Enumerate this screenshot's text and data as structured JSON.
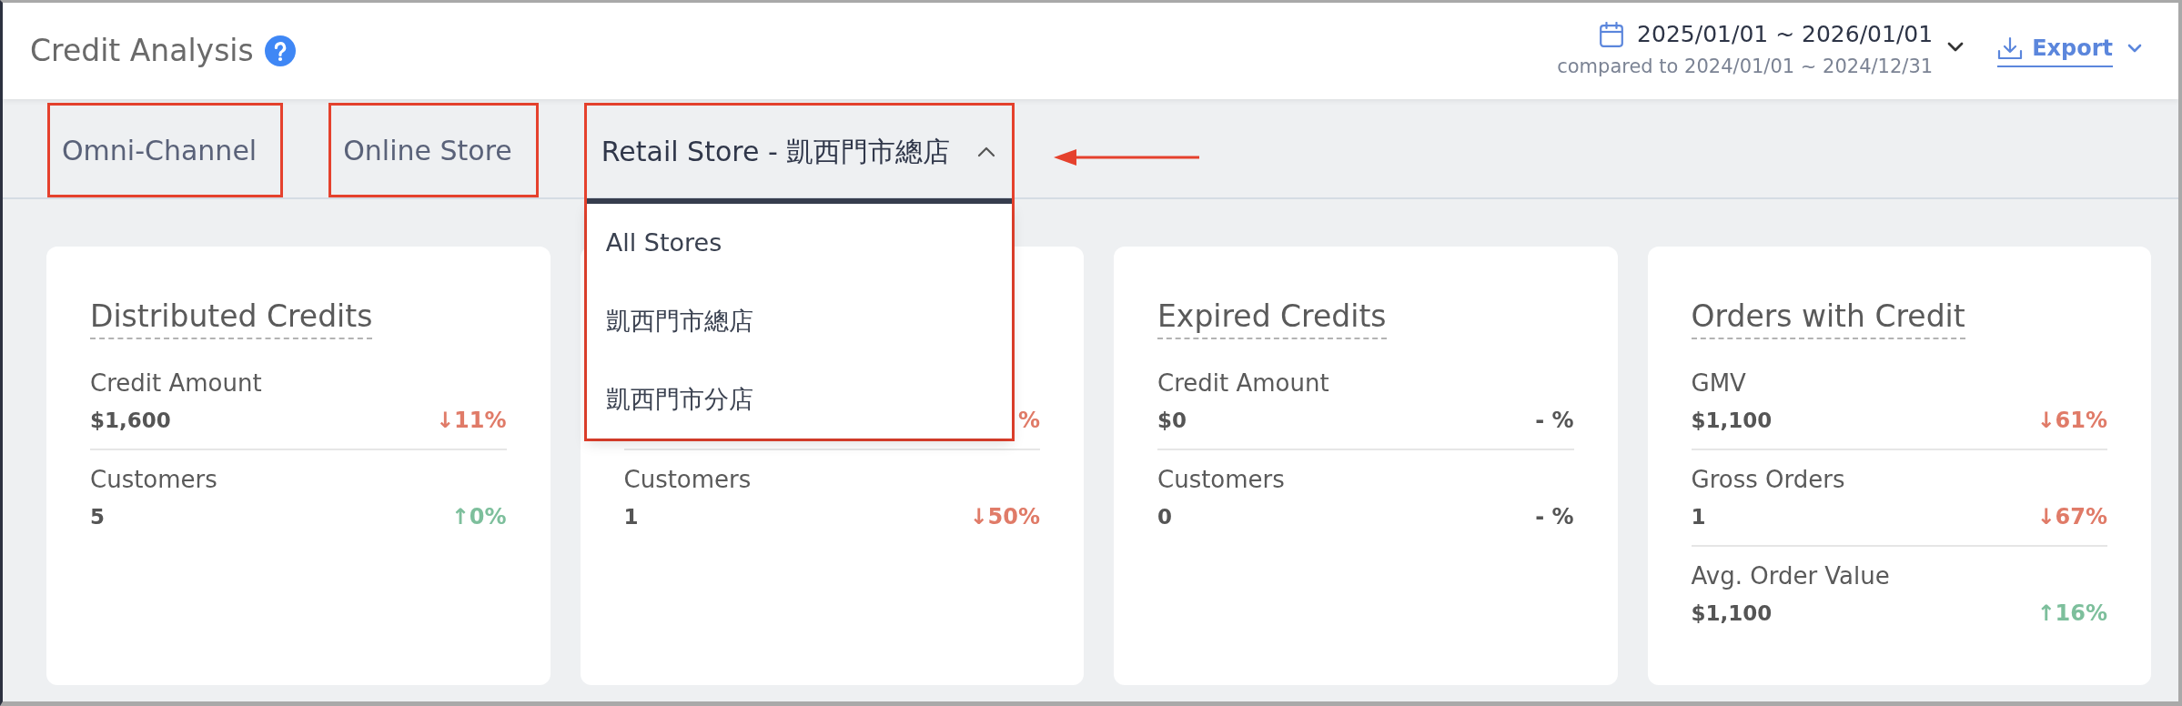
{
  "header": {
    "title": "Credit Analysis"
  },
  "date_range": {
    "range": "2025/01/01 ~ 2026/01/01",
    "comparison": "compared to 2024/01/01 ~ 2024/12/31"
  },
  "export": {
    "label": "Export"
  },
  "tabs": [
    {
      "label": "Omni-Channel",
      "kind": "plain",
      "selected": false,
      "annotation_box": true,
      "annotation_arrow": false
    },
    {
      "label": "Online Store",
      "kind": "plain",
      "selected": false,
      "annotation_box": true,
      "annotation_arrow": false
    },
    {
      "label": "Retail Store - 凱西門市總店",
      "kind": "dropdown",
      "selected": true,
      "expanded": true,
      "annotation_box": true,
      "annotation_arrow": true,
      "menu": [
        "All Stores",
        "凱西門市總店",
        "凱西門市分店"
      ]
    }
  ],
  "cards": [
    {
      "title": "Distributed Credits",
      "metrics": [
        {
          "label": "Credit Amount",
          "value": "$1,600",
          "change": "↓11%",
          "kind": "decrease"
        },
        {
          "label": "Customers",
          "value": "5",
          "change": "↑0%",
          "kind": "increase"
        }
      ]
    },
    {
      "metrics": [
        {
          "change": "%",
          "kind": "decrease"
        },
        {
          "label": "Customers",
          "value": "1",
          "change": "↓50%",
          "kind": "decrease"
        }
      ]
    },
    {
      "title": "Expired Credits",
      "metrics": [
        {
          "label": "Credit Amount",
          "value": "$0",
          "change": "- %",
          "kind": "neutral"
        },
        {
          "label": "Customers",
          "value": "0",
          "change": "- %",
          "kind": "neutral"
        }
      ]
    },
    {
      "title": "Orders with Credit",
      "metrics": [
        {
          "label": "GMV",
          "value": "$1,100",
          "change": "↓61%",
          "kind": "decrease"
        },
        {
          "label": "Gross Orders",
          "value": "1",
          "change": "↓67%",
          "kind": "decrease"
        },
        {
          "label": "Avg. Order Value",
          "value": "$1,100",
          "change": "↑16%",
          "kind": "increase"
        }
      ]
    }
  ]
}
